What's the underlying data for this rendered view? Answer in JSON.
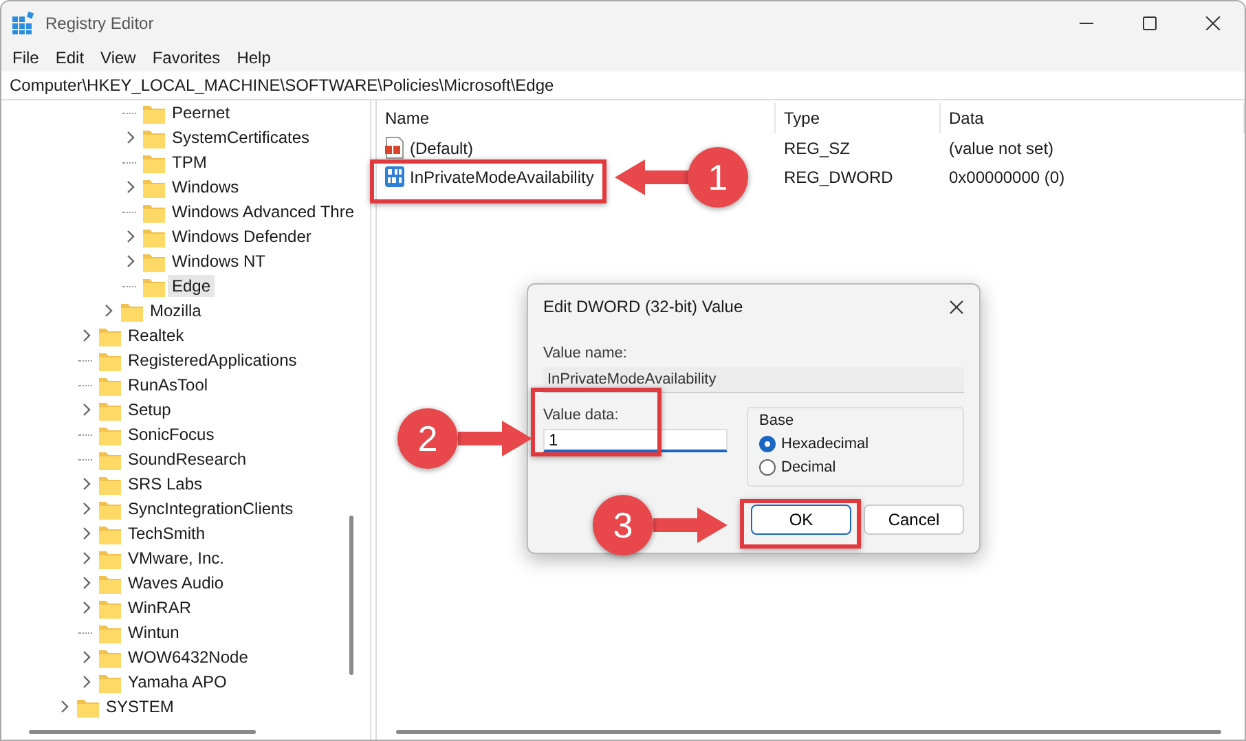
{
  "window": {
    "title": "Registry Editor"
  },
  "menu": [
    "File",
    "Edit",
    "View",
    "Favorites",
    "Help"
  ],
  "address": "Computer\\HKEY_LOCAL_MACHINE\\SOFTWARE\\Policies\\Microsoft\\Edge",
  "tree": {
    "items": [
      {
        "children": [
          {
            "children": [
              {
                "children": [
                  {
                    "label": "Peernet",
                    "expandable": false,
                    "selected": false
                  },
                  {
                    "label": "SystemCertificates",
                    "expandable": true,
                    "selected": false
                  },
                  {
                    "label": "TPM",
                    "expandable": false,
                    "selected": false
                  },
                  {
                    "label": "Windows",
                    "expandable": true,
                    "selected": false
                  },
                  {
                    "label": "Windows Advanced Thre",
                    "expandable": false,
                    "selected": false
                  },
                  {
                    "label": "Windows Defender",
                    "expandable": true,
                    "selected": false
                  },
                  {
                    "label": "Windows NT",
                    "expandable": true,
                    "selected": false
                  },
                  {
                    "label": "Edge",
                    "expandable": false,
                    "selected": true
                  }
                ]
              },
              {
                "label": "Mozilla",
                "expandable": true,
                "selected": false
              }
            ]
          },
          {
            "label": "Realtek",
            "expandable": true,
            "selected": false
          },
          {
            "label": "RegisteredApplications",
            "expandable": false,
            "selected": false
          },
          {
            "label": "RunAsTool",
            "expandable": false,
            "selected": false
          },
          {
            "label": "Setup",
            "expandable": true,
            "selected": false
          },
          {
            "label": "SonicFocus",
            "expandable": false,
            "selected": false
          },
          {
            "label": "SoundResearch",
            "expandable": false,
            "selected": false
          },
          {
            "label": "SRS Labs",
            "expandable": true,
            "selected": false
          },
          {
            "label": "SyncIntegrationClients",
            "expandable": true,
            "selected": false
          },
          {
            "label": "TechSmith",
            "expandable": true,
            "selected": false
          },
          {
            "label": "VMware, Inc.",
            "expandable": true,
            "selected": false
          },
          {
            "label": "Waves Audio",
            "expandable": true,
            "selected": false
          },
          {
            "label": "WinRAR",
            "expandable": true,
            "selected": false
          },
          {
            "label": "Wintun",
            "expandable": false,
            "selected": false
          },
          {
            "label": "WOW6432Node",
            "expandable": true,
            "selected": false
          },
          {
            "label": "Yamaha APO",
            "expandable": true,
            "selected": false
          }
        ]
      },
      {
        "label": "SYSTEM",
        "expandable": true,
        "selected": false
      }
    ]
  },
  "list": {
    "columns": [
      "Name",
      "Type",
      "Data"
    ],
    "rows": [
      {
        "kind": "string",
        "name": "(Default)",
        "type": "REG_SZ",
        "data": "(value not set)"
      },
      {
        "kind": "binary",
        "name": "InPrivateModeAvailability",
        "type": "REG_DWORD",
        "data": "0x00000000 (0)"
      }
    ]
  },
  "dialog": {
    "title": "Edit DWORD (32-bit) Value",
    "value_name_label": "Value name:",
    "value_name": "InPrivateModeAvailability",
    "value_data_label": "Value data:",
    "value_data": "1",
    "base_label": "Base",
    "bases": [
      {
        "label": "Hexadecimal",
        "selected": true
      },
      {
        "label": "Decimal",
        "selected": false
      }
    ],
    "buttons": [
      {
        "label": "OK",
        "default": true
      },
      {
        "label": "Cancel",
        "default": false
      }
    ]
  },
  "annotations": [
    {
      "number": "1"
    },
    {
      "number": "2"
    },
    {
      "number": "3"
    }
  ]
}
